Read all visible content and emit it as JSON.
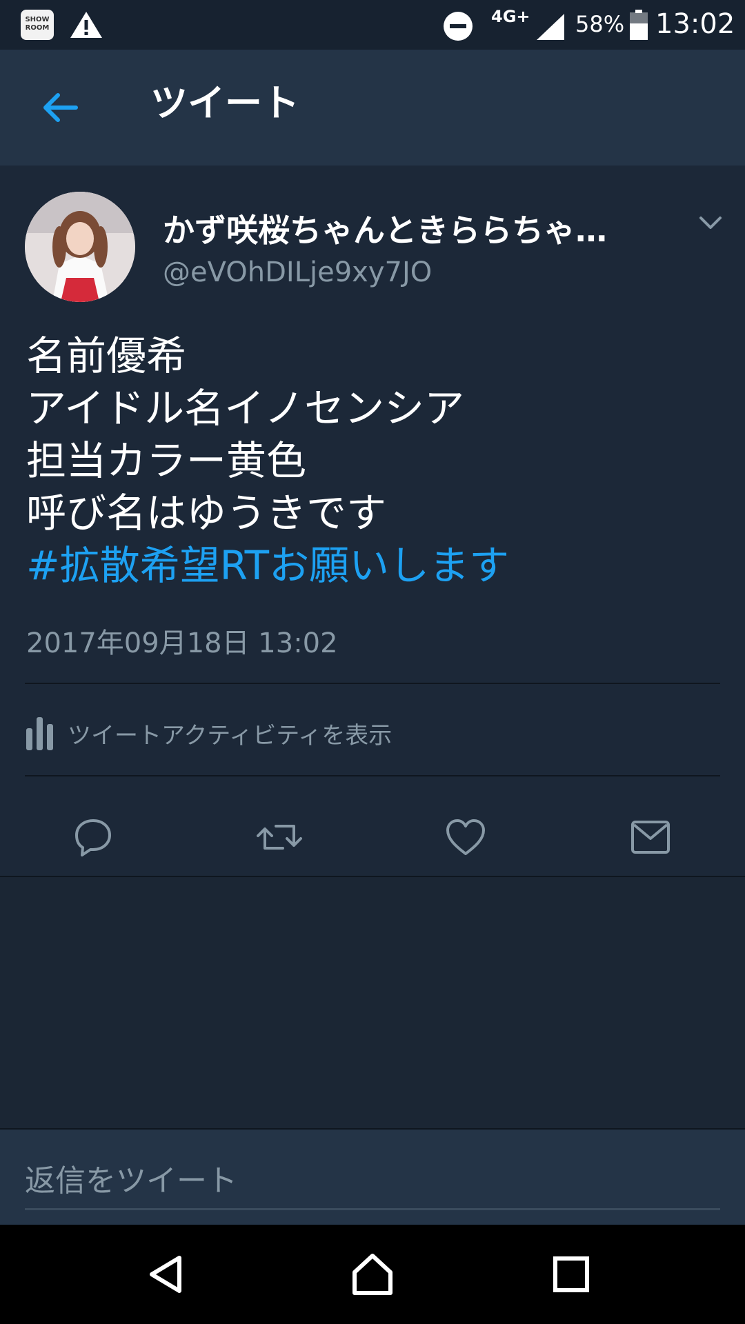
{
  "status_bar": {
    "app_badge": "SHOW ROOM",
    "network": "4G+",
    "battery": "58%",
    "time": "13:02"
  },
  "header": {
    "title": "ツイート"
  },
  "tweet": {
    "display_name": "かず咲桜ちゃんときららちゃ…",
    "handle": "@eVOhDILje9xy7JO",
    "lines": [
      "名前優希",
      "アイドル名イノセンシア",
      "担当カラー黄色",
      "呼び名はゆうきです"
    ],
    "hashtag": "#拡散希望RTお願いします",
    "timestamp": "2017年09月18日 13:02",
    "activity_label": "ツイートアクティビティを表示"
  },
  "reply": {
    "placeholder": "返信をツイート"
  },
  "colors": {
    "accent": "#1da1f2",
    "background": "#1b2634",
    "header": "#243447",
    "muted_text": "#8899a6"
  },
  "icons": [
    "showroom-icon",
    "warning-icon",
    "dnd-icon",
    "signal-icon",
    "battery-icon",
    "back-arrow-icon",
    "chevron-down-icon",
    "bar-chart-icon",
    "reply-icon",
    "retweet-icon",
    "like-icon",
    "dm-icon",
    "nav-back-icon",
    "nav-home-icon",
    "nav-recents-icon"
  ]
}
